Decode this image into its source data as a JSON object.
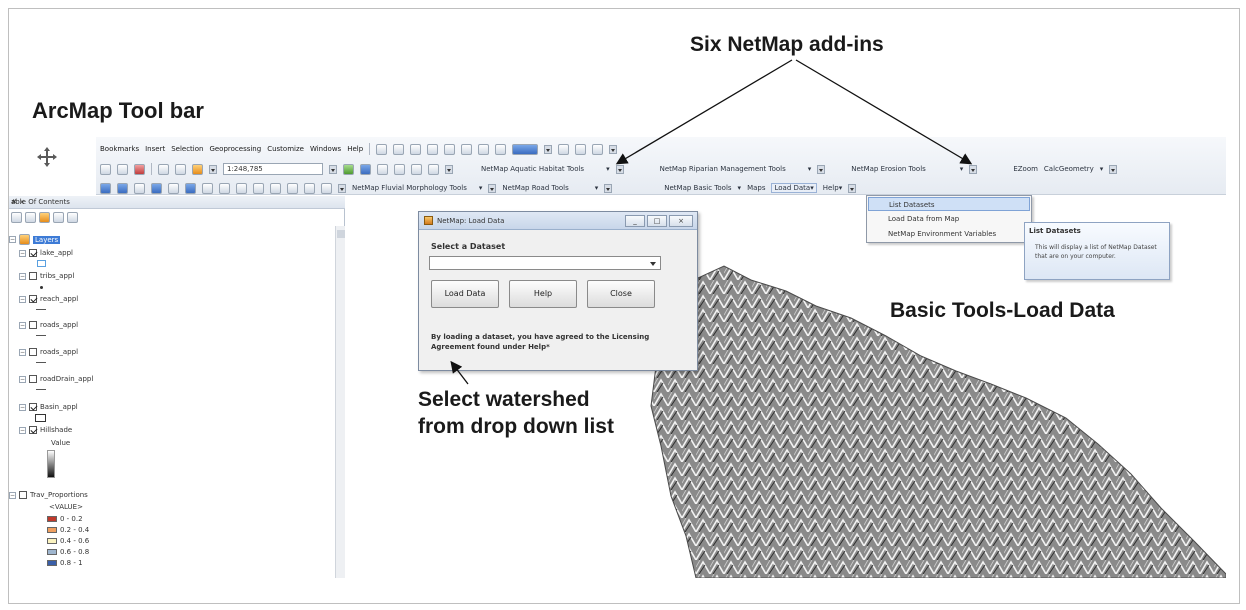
{
  "annotations": {
    "arcmap_toolbar": "ArcMap Tool bar",
    "six_addins": "Six NetMap add-ins",
    "basic_tools": "Basic Tools-Load Data",
    "select_watershed_line1": "Select watershed",
    "select_watershed_line2": "from drop down list"
  },
  "menubar": {
    "items": [
      "Bookmarks",
      "Insert",
      "Selection",
      "Geoprocessing",
      "Customize",
      "Windows",
      "Help"
    ]
  },
  "toolbar": {
    "scale_value": "1:248,785",
    "aquatic_habitat": "NetMap Aquatic Habitat Tools",
    "riparian": "NetMap Riparian Management Tools",
    "erosion": "NetMap Erosion Tools",
    "ezoom": "EZoom",
    "calc_geometry": "CalcGeometry",
    "fluvial": "NetMap Fluvial Morphology Tools",
    "road": "NetMap Road Tools",
    "basic": "NetMap Basic Tools",
    "maps": "Maps",
    "load_data": "Load Data",
    "help": "Help"
  },
  "toc": {
    "title": "able Of Contents",
    "pin": "# ×",
    "root": "Layers",
    "layers": [
      {
        "name": "lake_appl",
        "checked": true
      },
      {
        "name": "tribs_appl",
        "checked": false
      },
      {
        "name": "reach_appl",
        "checked": true
      },
      {
        "name": "roads_appl",
        "checked": false
      },
      {
        "name": "roads_appl",
        "checked": false
      },
      {
        "name": "roadDrain_appl",
        "checked": false
      },
      {
        "name": "Basin_appl",
        "checked": true
      },
      {
        "name": "Hillshade",
        "checked": true
      }
    ],
    "hillshade_value_label": "Value",
    "trav_layer": "Trav_Proportions",
    "trav_field": "<VALUE>",
    "legend": [
      {
        "label": "0 - 0.2",
        "color": "#c0392b"
      },
      {
        "label": "0.2 - 0.4",
        "color": "#f0a060"
      },
      {
        "label": "0.4 - 0.6",
        "color": "#fbf3c0"
      },
      {
        "label": "0.6 - 0.8",
        "color": "#9fb6cf"
      },
      {
        "label": "0.8 - 1",
        "color": "#3a5fa8"
      }
    ]
  },
  "dialog": {
    "title": "NetMap: Load Data",
    "label": "Select a Dataset",
    "selected_value": "",
    "load_button": "Load Data",
    "help_button": "Help",
    "close_button": "Close",
    "note": "By loading a dataset, you have agreed to the Licensing Agreement found under Help*"
  },
  "dropdown": {
    "items": [
      "List Datasets",
      "Load Data from Map",
      "NetMap Environment Variables"
    ],
    "highlighted_index": 0
  },
  "tooltip": {
    "title": "List Datasets",
    "body": "This will display a list of NetMap Dataset that are on your computer."
  },
  "colors": {
    "toolbar_bg": "#e6ebf2",
    "highlight": "#3d7bd6",
    "map_terrain": "#6a6a6a"
  }
}
